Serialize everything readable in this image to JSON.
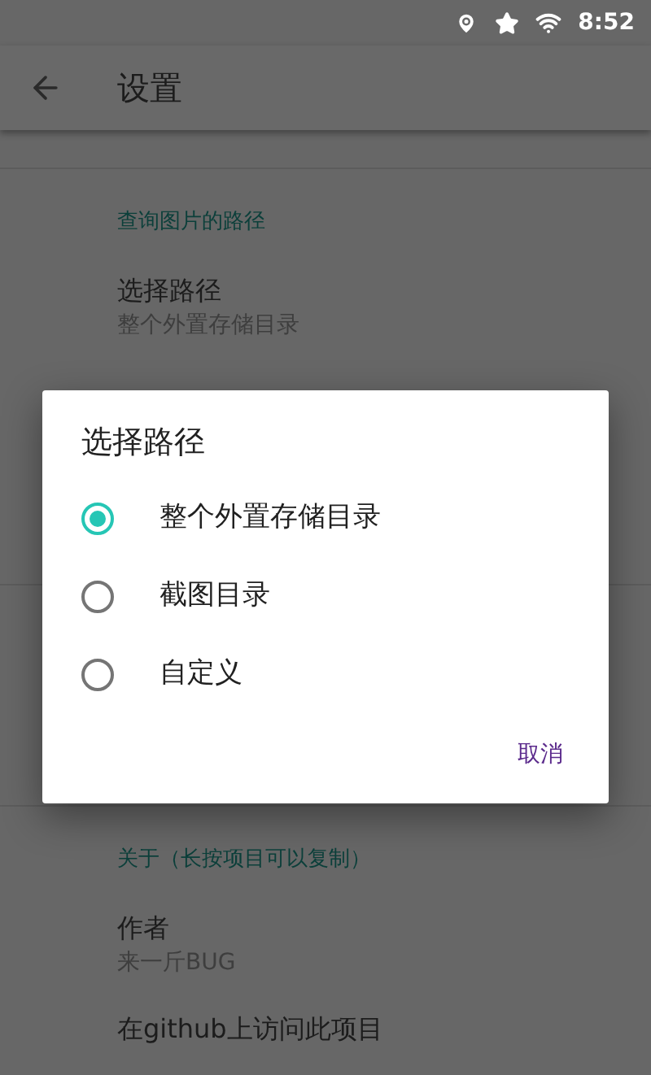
{
  "status_bar": {
    "time": "8:52"
  },
  "toolbar": {
    "title": "设置"
  },
  "sections": [
    {
      "category": "查询图片的路径",
      "items": [
        {
          "title": "选择路径",
          "summary": "整个外置存储目录"
        }
      ]
    },
    {
      "category": "关于（长按项目可以复制）",
      "items": [
        {
          "title": "作者",
          "summary": "来一斤BUG"
        },
        {
          "title": "在github上访问此项目"
        }
      ]
    }
  ],
  "dialog": {
    "title": "选择路径",
    "options": [
      {
        "label": "整个外置存储目录",
        "selected": true
      },
      {
        "label": "截图目录",
        "selected": false
      },
      {
        "label": "自定义",
        "selected": false
      }
    ],
    "buttons": [
      "取消"
    ]
  }
}
